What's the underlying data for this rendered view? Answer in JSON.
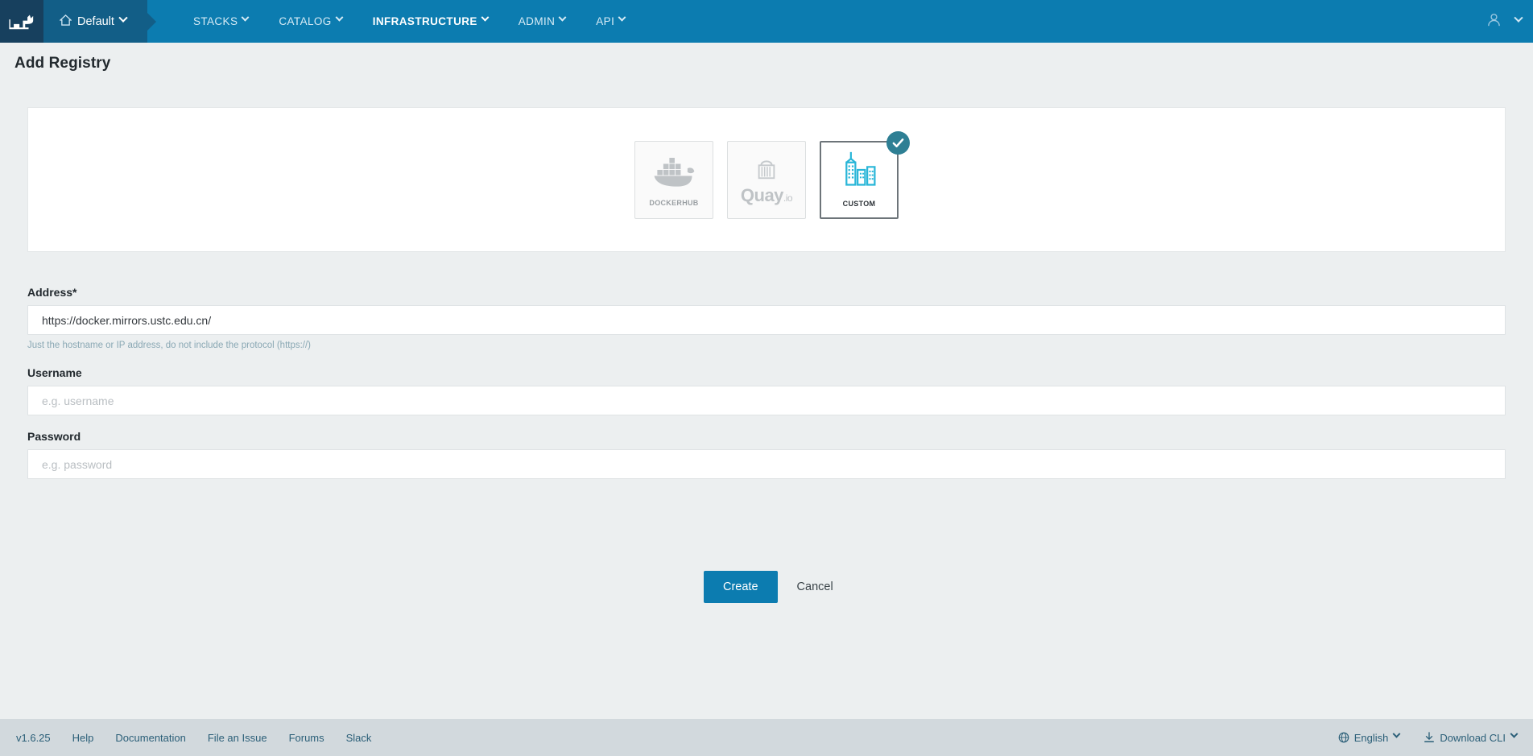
{
  "topnav": {
    "logo_icon": "rancher-cow-icon",
    "environment": {
      "icon": "home-icon",
      "label": "Default",
      "caret": "chevron-down-icon"
    },
    "items": [
      {
        "label": "STACKS",
        "active": false
      },
      {
        "label": "CATALOG",
        "active": false
      },
      {
        "label": "INFRASTRUCTURE",
        "active": true
      },
      {
        "label": "ADMIN",
        "active": false
      },
      {
        "label": "API",
        "active": false
      }
    ],
    "user": {
      "icon": "user-avatar-icon",
      "caret": "chevron-down-icon"
    }
  },
  "page": {
    "title": "Add Registry"
  },
  "registry": {
    "cards": [
      {
        "id": "dockerhub",
        "label": "DockerHub",
        "icon": "docker-whale-icon",
        "selected": false
      },
      {
        "id": "quay",
        "label": "Quay",
        "label_suffix": ".io",
        "icon": "quay-bucket-icon",
        "selected": false
      },
      {
        "id": "custom",
        "label": "Custom",
        "icon": "buildings-icon",
        "selected": true,
        "badge": "check-icon"
      }
    ]
  },
  "form": {
    "address": {
      "label": "Address*",
      "value": "https://docker.mirrors.ustc.edu.cn/",
      "placeholder": "",
      "hint": "Just the hostname or IP address, do not include the protocol (https://)"
    },
    "username": {
      "label": "Username",
      "value": "",
      "placeholder": "e.g. username"
    },
    "password": {
      "label": "Password",
      "value": "",
      "placeholder": "e.g. password"
    },
    "create_label": "Create",
    "cancel_label": "Cancel"
  },
  "footer": {
    "left": [
      {
        "label": "v1.6.25"
      },
      {
        "label": "Help"
      },
      {
        "label": "Documentation"
      },
      {
        "label": "File an Issue"
      },
      {
        "label": "Forums"
      },
      {
        "label": "Slack"
      }
    ],
    "right": [
      {
        "label": "English",
        "icon": "globe-icon",
        "caret": "chevron-down-icon"
      },
      {
        "label": "Download CLI",
        "icon": "download-icon",
        "caret": "chevron-down-icon"
      }
    ]
  },
  "colors": {
    "nav_blue": "#0c7cb0",
    "nav_dark": "#17405e",
    "env_blue": "#125e87",
    "page_bg": "#eceff0",
    "footer_bg": "#d2d9dd",
    "accent_teal": "#2e7f94",
    "custom_icon_cyan": "#29b6d8",
    "link_blue": "#2b5f78",
    "hint_blue": "#8aa8b4"
  }
}
